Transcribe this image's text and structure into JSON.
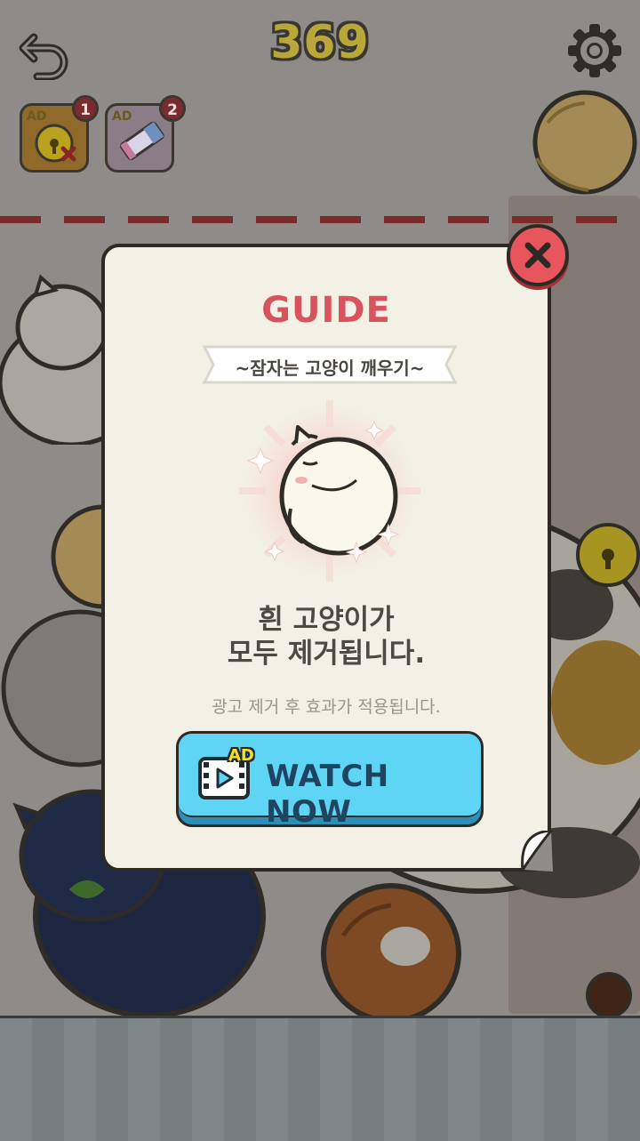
{
  "hud": {
    "score": "369",
    "boosters": [
      {
        "ad_label": "AD",
        "badge": "1",
        "icon": "golden-bell-remove-icon"
      },
      {
        "ad_label": "AD",
        "badge": "2",
        "icon": "churu-treat-icon",
        "package_text": "Chu Chu"
      }
    ]
  },
  "modal": {
    "title": "GUIDE",
    "subtitle": "~잠자는 고양이 깨우기~",
    "desc_line1": "흰 고양이가",
    "desc_line2": "모두 제거됩니다.",
    "note": "광고 제거 후 효과가 적용됩니다.",
    "watch_button": {
      "ad_badge": "AD",
      "label": "WATCH NOW"
    }
  },
  "colors": {
    "title": "#d9535c",
    "button": "#5fd5f6",
    "close": "#e8555c",
    "dash_line": "#7d2a2a"
  }
}
